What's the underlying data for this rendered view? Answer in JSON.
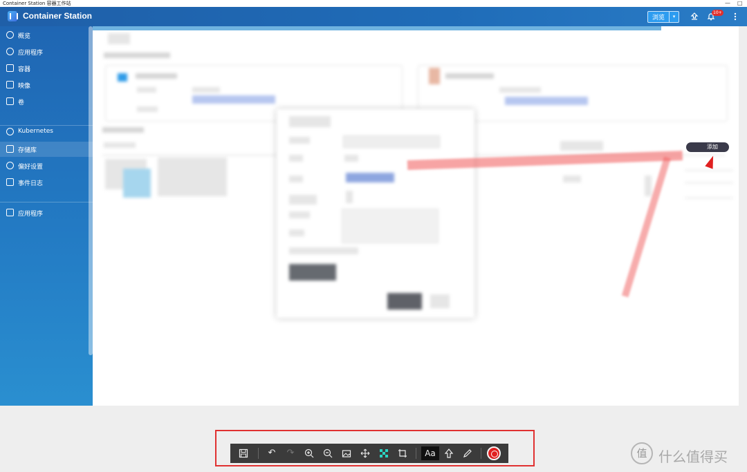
{
  "window": {
    "title": "Container Station 容器工作站",
    "controls": [
      "—",
      "□"
    ]
  },
  "header": {
    "app_name": "Container Station",
    "browse_label": "浏览",
    "dropdown_symbol": "▾",
    "notification_badge": "10+",
    "icons": [
      "logo-icon",
      "caret-down-icon",
      "upload-icon",
      "bell-icon",
      "more-vertical-icon"
    ]
  },
  "sidebar": {
    "items": [
      {
        "label": "概览",
        "icon": "dashboard-icon"
      },
      {
        "label": "应用程序",
        "icon": "apps-icon"
      },
      {
        "label": "容器",
        "icon": "container-icon"
      },
      {
        "label": "映像",
        "icon": "images-icon"
      },
      {
        "label": "卷",
        "icon": "volume-icon"
      },
      {
        "label": "Kubernetes",
        "icon": "kubernetes-icon"
      },
      {
        "label": "存储库",
        "icon": "repository-icon",
        "active": true
      },
      {
        "label": "偏好设置",
        "icon": "preferences-icon"
      },
      {
        "label": "事件日志",
        "icon": "event-log-icon"
      },
      {
        "label": "应用程序",
        "icon": "app-center-icon"
      }
    ]
  },
  "main": {
    "add_button_label": "添加"
  },
  "bottom_toolbar": {
    "text_tool_label": "Aa",
    "tools": [
      "save-icon",
      "undo-icon",
      "redo-icon",
      "zoom-in-icon",
      "zoom-out-icon",
      "image-icon",
      "move-icon",
      "mosaic-icon",
      "crop-icon",
      "text-tool",
      "arrow-tool-icon",
      "pencil-icon",
      "record-icon"
    ]
  },
  "watermark": {
    "logo_char": "值",
    "text": "什么值得买"
  },
  "colors": {
    "brand_blue": "#1f66b3",
    "annotation_red": "#e03030",
    "toolbar_bg": "#3b3b3b"
  }
}
